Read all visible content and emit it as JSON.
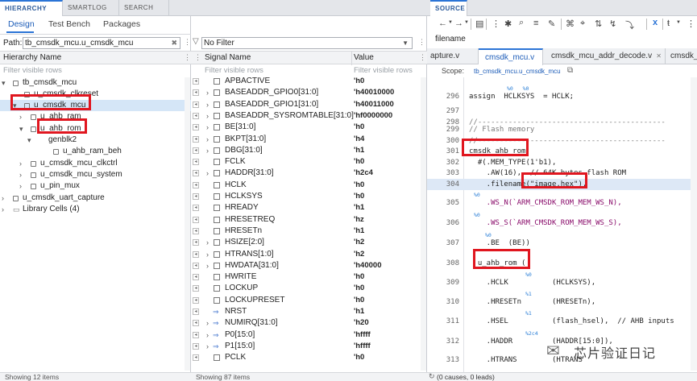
{
  "left_tabs": [
    "HIERARCHY",
    "SMARTLOG",
    "SEARCH"
  ],
  "subtabs": [
    "Design",
    "Test Bench",
    "Packages"
  ],
  "path_label": "Path:",
  "path_value": "tb_cmsdk_mcu.u_cmsdk_mcu",
  "filter_select": "No Filter",
  "hier_header": "Hierarchy Name",
  "hier_filter": "Filter visible rows",
  "hier_items": [
    "tb_cmsdk_mcu",
    "u_cmsdk_clkreset",
    "u_cmsdk_mcu",
    "u_ahb_ram",
    "u_ahb_rom",
    "genblk2",
    "u_ahb_ram_beh",
    "u_cmsdk_mcu_clkctrl",
    "u_cmsdk_mcu_system",
    "u_pin_mux",
    "u_cmsdk_uart_capture",
    "Library Cells (4)"
  ],
  "hier_footer": "Showing 12 items",
  "sig_header_name": "Signal Name",
  "sig_header_value": "Value",
  "sig_filter_name": "Filter visible rows",
  "sig_filter_value": "Filter visible rows",
  "signals": [
    {
      "name": "APBACTIVE",
      "value": "'h0"
    },
    {
      "name": "BASEADDR_GPIO0[31:0]",
      "value": "'h40010000"
    },
    {
      "name": "BASEADDR_GPIO1[31:0]",
      "value": "'h40011000"
    },
    {
      "name": "BASEADDR_SYSROMTABLE[31:0]",
      "value": "'hf0000000"
    },
    {
      "name": "BE[31:0]",
      "value": "'h0"
    },
    {
      "name": "BKPT[31:0]",
      "value": "'h4"
    },
    {
      "name": "DBG[31:0]",
      "value": "'h1"
    },
    {
      "name": "FCLK",
      "value": "'h0"
    },
    {
      "name": "HADDR[31:0]",
      "value": "'h2c4"
    },
    {
      "name": "HCLK",
      "value": "'h0"
    },
    {
      "name": "HCLKSYS",
      "value": "'h0"
    },
    {
      "name": "HREADY",
      "value": "'h1"
    },
    {
      "name": "HRESETREQ",
      "value": "'hz"
    },
    {
      "name": "HRESETn",
      "value": "'h1"
    },
    {
      "name": "HSIZE[2:0]",
      "value": "'h2"
    },
    {
      "name": "HTRANS[1:0]",
      "value": "'h2"
    },
    {
      "name": "HWDATA[31:0]",
      "value": "'h40000"
    },
    {
      "name": "HWRITE",
      "value": "'h0"
    },
    {
      "name": "LOCKUP",
      "value": "'h0"
    },
    {
      "name": "LOCKUPRESET",
      "value": "'h0"
    },
    {
      "name": "NRST",
      "value": "'h1"
    },
    {
      "name": "NUMIRQ[31:0]",
      "value": "'h20"
    },
    {
      "name": "P0[15:0]",
      "value": "'hffff"
    },
    {
      "name": "P1[15:0]",
      "value": "'hffff"
    },
    {
      "name": "PCLK",
      "value": "'h0"
    }
  ],
  "sig_footer": "Showing 87 items",
  "source_tab": "SOURCE",
  "filename_label": "filename",
  "file_tabs": [
    "apture.v",
    "cmsdk_mcu.v",
    "cmsdk_mcu_addr_decode.v",
    "cmsdk_"
  ],
  "scope_label": "Scope:",
  "scope_value": "tb_cmsdk_mcu.u_cmsdk_mcu",
  "code_lines": [
    {
      "n": "296",
      "t": "assign  HCLKSYS  = HCLK;",
      "h": "%0   %0"
    },
    {
      "n": "297",
      "t": "",
      "h": ""
    },
    {
      "n": "298",
      "t": "//-------------------------------------------",
      "h": ""
    },
    {
      "n": "299",
      "t": "// Flash memory",
      "h": ""
    },
    {
      "n": "300",
      "t": "//-------------------------------------------",
      "h": ""
    },
    {
      "n": "301",
      "t": "cmsdk_ahb_rom",
      "h": ""
    },
    {
      "n": "302",
      "t": "  #(.MEM_TYPE(1'b1),",
      "h": ""
    },
    {
      "n": "303",
      "t": "    .AW(16),  // 64K bytes flash ROM",
      "h": ""
    },
    {
      "n": "304",
      "t": "    .filename(\"image.hex\"),",
      "h": ""
    },
    {
      "n": "305",
      "t": "    .WS_N(`ARM_CMSDK_ROM_MEM_WS_N),",
      "h": "%0"
    },
    {
      "n": "306",
      "t": "    .WS_S(`ARM_CMSDK_ROM_MEM_WS_S),",
      "h": "%0"
    },
    {
      "n": "307",
      "t": "    .BE  (BE))",
      "h": "%0"
    },
    {
      "n": "308",
      "t": "  u_ahb_rom (",
      "h": ""
    },
    {
      "n": "309",
      "t": "    .HCLK          (HCLKSYS),",
      "h": "%0"
    },
    {
      "n": "310",
      "t": "    .HRESETn       (HRESETn),",
      "h": "%1"
    },
    {
      "n": "311",
      "t": "    .HSEL          (flash_hsel),  // AHB inputs",
      "h": "%1"
    },
    {
      "n": "312",
      "t": "    .HADDR         (HADDR[15:0]),",
      "h": "%2c4"
    },
    {
      "n": "313",
      "t": "    .HTRANS        (HTRANS",
      "h": ""
    }
  ],
  "status_text": "(0 causes, 0 leads)",
  "watermark": "芯片验证日记",
  "colors": {
    "accent": "#2b74d6",
    "highlight": "#e0161f",
    "hint": "#2b7fd6"
  }
}
